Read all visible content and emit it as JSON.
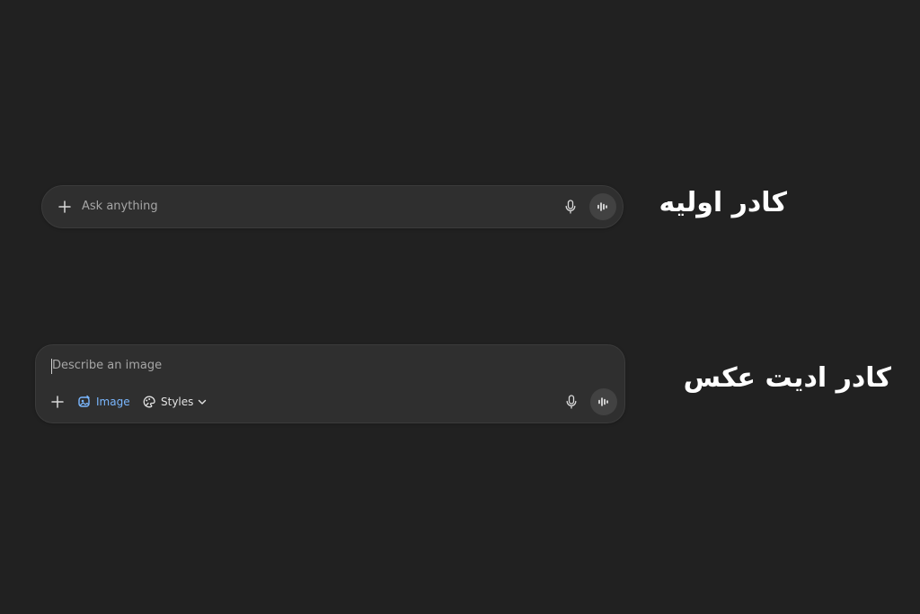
{
  "basic_composer": {
    "placeholder": "Ask anything",
    "caption": "کادر اولیه",
    "icons": {
      "add": "plus-icon",
      "mic": "microphone-icon",
      "voice": "voice-waveform-icon"
    }
  },
  "image_composer": {
    "placeholder": "Describe an image",
    "caption": "کادر ادیت عکس",
    "tools": {
      "image_label": "Image",
      "styles_label": "Styles"
    },
    "icons": {
      "add": "plus-icon",
      "image": "image-edit-icon",
      "styles": "brush-palette-icon",
      "dropdown": "chevron-down-icon",
      "mic": "microphone-icon",
      "voice": "voice-waveform-icon"
    }
  },
  "colors": {
    "background": "#212121",
    "composer_background": "#2f2f2f",
    "composer_border": "#3b3b3b",
    "voice_button": "#424242",
    "placeholder": "#a6a6a6",
    "accent_image": "#7ab7ff",
    "caption": "#ffffff"
  }
}
